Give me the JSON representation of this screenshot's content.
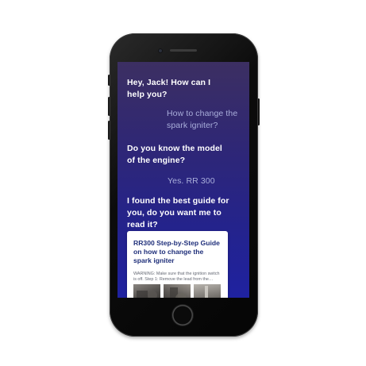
{
  "chat": {
    "messages": [
      {
        "sender": "assistant",
        "text": "Hey, Jack! How can I help you?"
      },
      {
        "sender": "user",
        "text": "How to change the spark igniter?"
      },
      {
        "sender": "assistant",
        "text": "Do you know the model of the engine?"
      },
      {
        "sender": "user",
        "text": "Yes. RR 300"
      },
      {
        "sender": "assistant",
        "text": "I found the best guide for you, do you want me to read it?"
      }
    ]
  },
  "guide_card": {
    "title": "RR300 Step-by-Step Guide on how to change the spark igniter",
    "snippet": "WARNING: Make sure that the ignition switch is off. Step 1: Remove the lead from the…",
    "thumbnails": [
      "engine-photo-1",
      "engine-photo-2",
      "engine-photo-3"
    ]
  },
  "colors": {
    "screen_top": "#3c2f62",
    "screen_bottom": "#1f22a0",
    "assistant_text": "#ffffff",
    "user_text": "#a9aedb",
    "card_title": "#1f2f7a"
  }
}
